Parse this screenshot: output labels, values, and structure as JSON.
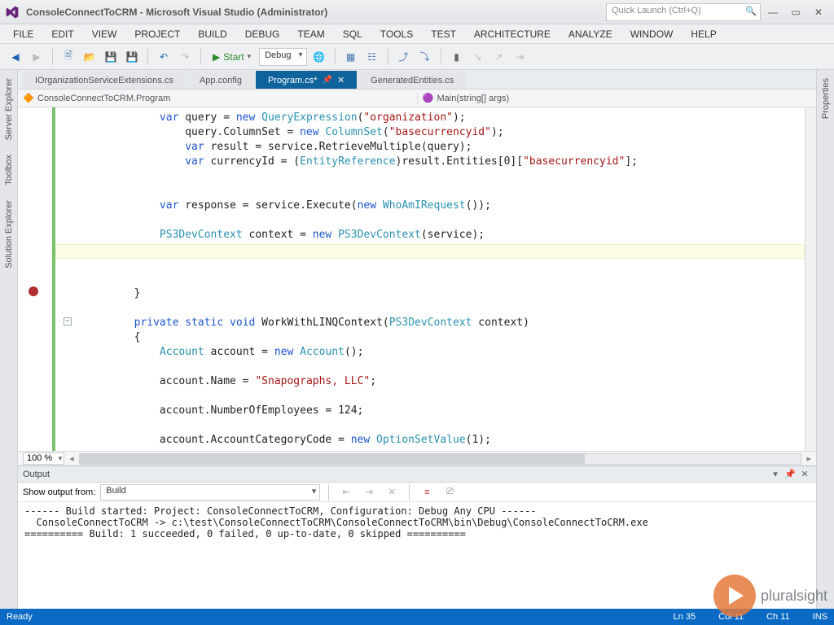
{
  "title": "ConsoleConnectToCRM - Microsoft Visual Studio (Administrator)",
  "quick_launch_placeholder": "Quick Launch (Ctrl+Q)",
  "menus": [
    "FILE",
    "EDIT",
    "VIEW",
    "PROJECT",
    "BUILD",
    "DEBUG",
    "TEAM",
    "SQL",
    "TOOLS",
    "TEST",
    "ARCHITECTURE",
    "ANALYZE",
    "WINDOW",
    "HELP"
  ],
  "toolbar": {
    "start_label": "Start",
    "config": "Debug"
  },
  "left_rails": [
    "Server Explorer",
    "Toolbox",
    "Solution Explorer"
  ],
  "right_rails": [
    "Properties"
  ],
  "doc_tabs": [
    {
      "label": "IOrganizationServiceExtensions.cs",
      "active": false
    },
    {
      "label": "App.config",
      "active": false
    },
    {
      "label": "Program.cs*",
      "active": true
    },
    {
      "label": "GeneratedEntities.cs",
      "active": false
    }
  ],
  "nav_left": "ConsoleConnectToCRM.Program",
  "nav_right": "Main(string[] args)",
  "zoom": "100 %",
  "code": {
    "l1a": "var",
    "l1b": " query = ",
    "l1c": "new",
    "l1d": " ",
    "l1e": "QueryExpression",
    "l1f": "(",
    "l1g": "\"organization\"",
    "l1h": ");",
    "l2a": "    query.ColumnSet = ",
    "l2b": "new",
    "l2c": " ",
    "l2d": "ColumnSet",
    "l2e": "(",
    "l2f": "\"basecurrencyid\"",
    "l2g": ");",
    "l3a": "    ",
    "l3b": "var",
    "l3c": " result = service.RetrieveMultiple(query);",
    "l4a": "    ",
    "l4b": "var",
    "l4c": " currencyId = (",
    "l4d": "EntityReference",
    "l4e": ")result.Entities[0][",
    "l4f": "\"basecurrencyid\"",
    "l4g": "];",
    "l6a": "var",
    "l6b": " response = service.Execute(",
    "l6c": "new",
    "l6d": " ",
    "l6e": "WhoAmIRequest",
    "l6f": "());",
    "l8a": "PS3DevContext",
    "l8b": " context = ",
    "l8c": "new",
    "l8d": " ",
    "l8e": "PS3DevContext",
    "l8f": "(service);",
    "l12": "}",
    "l14a": "private",
    "l14b": " ",
    "l14c": "static",
    "l14d": " ",
    "l14e": "void",
    "l14f": " WorkWithLINQContext(",
    "l14g": "PS3DevContext",
    "l14h": " context)",
    "l15": "{",
    "l16a": "    ",
    "l16b": "Account",
    "l16c": " account = ",
    "l16d": "new",
    "l16e": " ",
    "l16f": "Account",
    "l16g": "();",
    "l18a": "    account.Name = ",
    "l18b": "\"Snapographs, LLC\"",
    "l18c": ";",
    "l20a": "    account.NumberOfEmployees = 124;",
    "l22a": "    account.AccountCategoryCode = ",
    "l22b": "new",
    "l22c": " ",
    "l22d": "OptionSetValue",
    "l22e": "(1);"
  },
  "output": {
    "title": "Output",
    "show_from_label": "Show output from:",
    "show_from_value": "Build",
    "lines": [
      "------ Build started: Project: ConsoleConnectToCRM, Configuration: Debug Any CPU ------",
      "  ConsoleConnectToCRM -> c:\\test\\ConsoleConnectToCRM\\ConsoleConnectToCRM\\bin\\Debug\\ConsoleConnectToCRM.exe",
      "========== Build: 1 succeeded, 0 failed, 0 up-to-date, 0 skipped =========="
    ]
  },
  "status": {
    "ready": "Ready",
    "ln": "Ln 35",
    "col": "Col 11",
    "ch": "Ch 11",
    "ins": "INS"
  },
  "brand": "pluralsight"
}
